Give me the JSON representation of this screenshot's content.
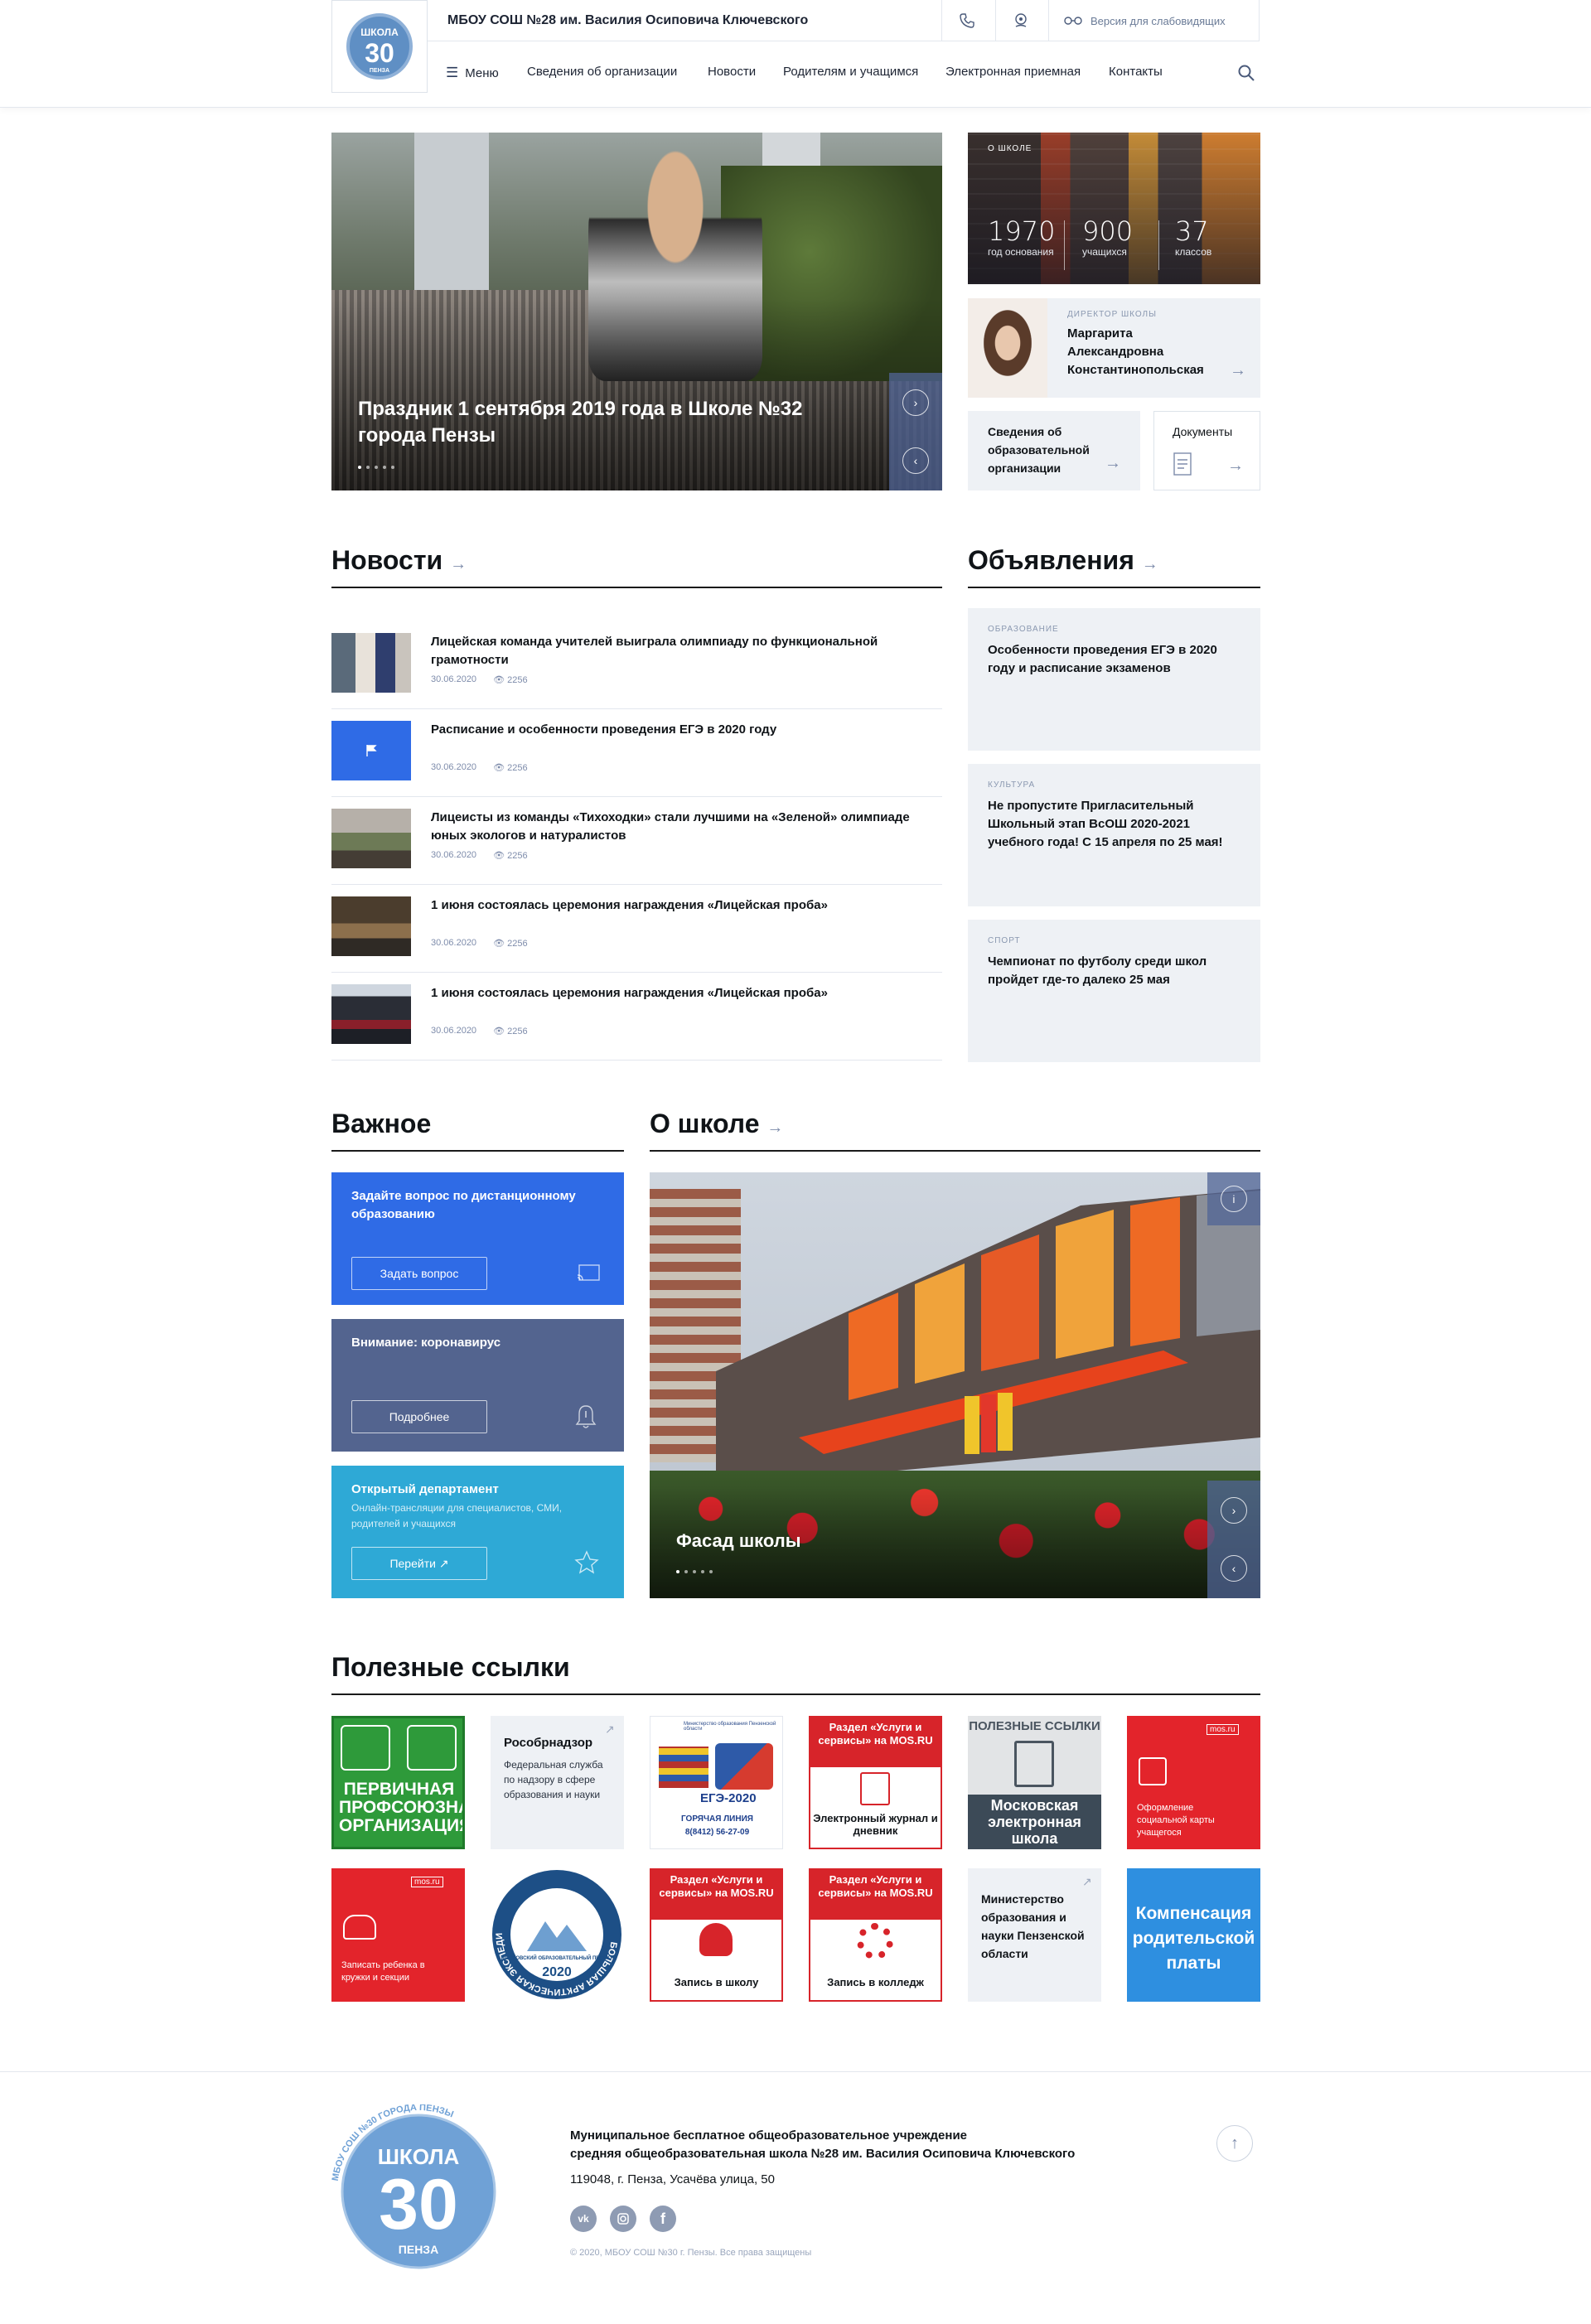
{
  "header": {
    "school_name": "МБОУ СОШ №28 им. Василия Осиповича Ключевского",
    "logo": {
      "word": "ШКОЛА",
      "number": "30",
      "city": "ПЕНЗА"
    },
    "vision_label": "Версия для слабовидящих",
    "menu_label": "Меню",
    "nav": [
      "Сведения об организации",
      "Новости",
      "Родителям и учащимся",
      "Электронная приемная",
      "Контакты"
    ]
  },
  "hero": {
    "title": "Праздник 1 сентября 2019 года в Школе №32 города Пензы"
  },
  "about": {
    "label": "О ШКОЛЕ",
    "stats": [
      {
        "number": "1970",
        "label": "год основания"
      },
      {
        "number": "900",
        "label": "учащихся"
      },
      {
        "number": "37",
        "label": "классов"
      }
    ]
  },
  "director": {
    "caption": "ДИРЕКТОР ШКОЛЫ",
    "name": "Маргарита Александровна Константинопольская"
  },
  "info_tile": {
    "label": "Сведения об образовательной организации"
  },
  "docs_tile": {
    "label": "Документы"
  },
  "news": {
    "title": "Новости",
    "items": [
      {
        "title": "Лицейская команда учителей выиграла олимпиаду по функциональной грамотности",
        "date": "30.06.2020",
        "views": "2256"
      },
      {
        "title": "Расписание и особенности проведения ЕГЭ в 2020 году",
        "date": "30.06.2020",
        "views": "2256"
      },
      {
        "title": "Лицеисты из команды «Тихоходки» стали лучшими на «Зеленой» олимпиаде юных экологов и натуралистов",
        "date": "30.06.2020",
        "views": "2256"
      },
      {
        "title": "1 июня состоялась церемония награждения «Лицейская проба»",
        "date": "30.06.2020",
        "views": "2256"
      },
      {
        "title": "1 июня состоялась церемония награждения «Лицейская проба»",
        "date": "30.06.2020",
        "views": "2256"
      }
    ]
  },
  "announcements": {
    "title": "Объявления",
    "items": [
      {
        "category": "ОБРАЗОВАНИЕ",
        "text": "Особенности проведения ЕГЭ в 2020 году и расписание экзаменов"
      },
      {
        "category": "КУЛЬТУРА",
        "text": "Не пропустите Пригласительный Школьный этап ВсОШ 2020-2021 учебного года! С 15 апреля по 25 мая!"
      },
      {
        "category": "СПОРТ",
        "text": "Чемпионат по футболу среди школ пройдет где-то далеко 25 мая"
      }
    ]
  },
  "important": {
    "title": "Важное",
    "items": [
      {
        "title": "Задайте вопрос по дистанционному образованию",
        "subtitle": "",
        "button": "Задать вопрос",
        "color": "#2f6be6"
      },
      {
        "title": "Внимание: коронавирус",
        "subtitle": "",
        "button": "Подробнее",
        "color": "#53648f"
      },
      {
        "title": "Открытый департамент",
        "subtitle": "Онлайн-трансляции для специалистов, СМИ, родителей и учащихся",
        "button": "Перейти ↗",
        "color": "#2ea9d6"
      }
    ]
  },
  "about_school": {
    "title": "О школе",
    "caption": "Фасад школы"
  },
  "links": {
    "title": "Полезные ссылки",
    "row1": [
      {
        "text": "ПЕРВИЧНАЯ ПРОФСОЮЗНАЯ ОРГАНИЗАЦИЯ"
      },
      {
        "title": "Рособрнадзор",
        "text": "Федеральная служба по надзору в сфере образования и науки"
      },
      {
        "top": "Министерство образования Пензенской области",
        "label": "ЕГЭ-2020",
        "hotline": "ГОРЯЧАЯ ЛИНИЯ",
        "phone": "8(8412) 56-27-09"
      },
      {
        "head": "Раздел «Услуги и сервисы» на MOS.RU",
        "text": "Электронный журнал и дневник"
      },
      {
        "head": "ПОЛЕЗНЫЕ ССЫЛКИ",
        "text": "Московская электронная школа"
      },
      {
        "badge": "mos.ru",
        "text": "Оформление социальной карты учащегося"
      }
    ],
    "row2": [
      {
        "badge": "mos.ru",
        "text": "Записать ребенка в кружки и секции"
      },
      {
        "ring": "БОЛЬШАЯ АРКТИЧЕСКАЯ ЭКСПЕДИЦИЯ",
        "inner": "МОСКОВСКИЙ ОБРАЗОВАТЕЛЬНЫЙ ПРОЕКТ",
        "year": "2020"
      },
      {
        "head": "Раздел «Услуги и сервисы» на MOS.RU",
        "text": "Запись в школу"
      },
      {
        "head": "Раздел «Услуги и сервисы» на MOS.RU",
        "text": "Запись в колледж"
      },
      {
        "text": "Министерство образования и науки Пензенской области"
      },
      {
        "text": "Компенсация родительской платы"
      }
    ]
  },
  "footer": {
    "org_line1": "Муниципальное бесплатное общеобразовательное учреждение",
    "org_line2": "средняя общеобразовательная школа №28 им. Василия Осиповича Ключевского",
    "address": "119048, г. Пенза, Усачёва улица, 50",
    "copyright": "© 2020, МБОУ СОШ №30 г. Пензы. Все права защищены",
    "logo_ring": "МБОУ СОШ №30 ГОРОДА ПЕНЗЫ"
  }
}
